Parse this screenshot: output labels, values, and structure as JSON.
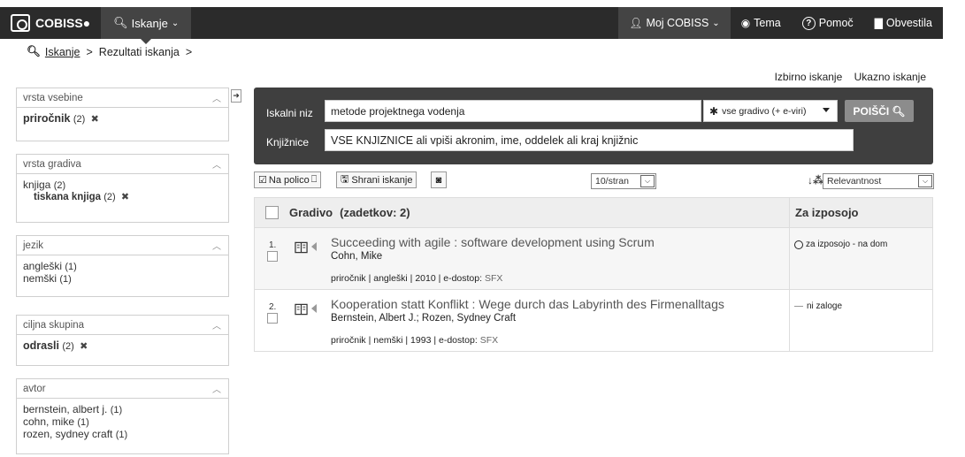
{
  "nav": {
    "brand": "COBISS",
    "search_menu": "Iskanje",
    "my_cobiss": "Moj COBISS",
    "theme": "Tema",
    "help": "Pomoč",
    "notices": "Obvestila"
  },
  "breadcrumb": {
    "search": "Iskanje",
    "results": "Rezultati iskanja",
    "sep": ">"
  },
  "adv_links": {
    "selective": "Izbirno iskanje",
    "command": "Ukazno iskanje"
  },
  "facets": [
    {
      "title": "vrsta vsebine",
      "items": [
        {
          "label": "priročnik",
          "count": "(2)",
          "selected": true
        }
      ]
    },
    {
      "title": "vrsta gradiva",
      "items": [
        {
          "label": "knjiga",
          "count": "(2)"
        },
        {
          "label": "tiskana knjiga",
          "count": "(2)",
          "sub": true,
          "selected": true
        }
      ]
    },
    {
      "title": "jezik",
      "items": [
        {
          "label": "angleški",
          "count": "(1)"
        },
        {
          "label": "nemški",
          "count": "(1)"
        }
      ]
    },
    {
      "title": "ciljna skupina",
      "items": [
        {
          "label": "odrasli",
          "count": "(2)",
          "selected": true
        }
      ]
    },
    {
      "title": "avtor",
      "items": [
        {
          "label": "bernstein, albert j.",
          "count": "(1)"
        },
        {
          "label": "cohn, mike",
          "count": "(1)"
        },
        {
          "label": "rozen, sydney craft",
          "count": "(1)"
        }
      ]
    }
  ],
  "search": {
    "query_label": "Iskalni niz",
    "query_value": "metode projektnega vodenja",
    "material_select": "vse gradivo (+ e-viri)",
    "search_button": "POIŠČI",
    "libraries_label": "Knjižnice",
    "libraries_value": "VSE KNJIZNICE ali vpiši akronim, ime, oddelek ali kraj knjižnic"
  },
  "toolbar": {
    "shelf": "Na polico",
    "save_search": "Shrani iskanje",
    "per_page": "10/stran",
    "sort": "Relevantnost"
  },
  "results": {
    "header_material": "Gradivo",
    "header_hits": "(zadetkov: 2)",
    "header_availability": "Za izposojo",
    "rows": [
      {
        "num": "1.",
        "title": "Succeeding with agile : software development using Scrum",
        "author": "Cohn, Mike",
        "meta": "priročnik | angleški | 2010 | e-dostop: ",
        "sfx": "SFX",
        "availability": "za izposojo - na dom"
      },
      {
        "num": "2.",
        "title": "Kooperation statt Konflikt : Wege durch das Labyrinth des Firmenalltags",
        "author": "Bernstein, Albert J.; Rozen, Sydney Craft",
        "meta": "priročnik | nemški | 1993 | e-dostop: ",
        "sfx": "SFX",
        "availability": "ni zaloge"
      }
    ]
  }
}
